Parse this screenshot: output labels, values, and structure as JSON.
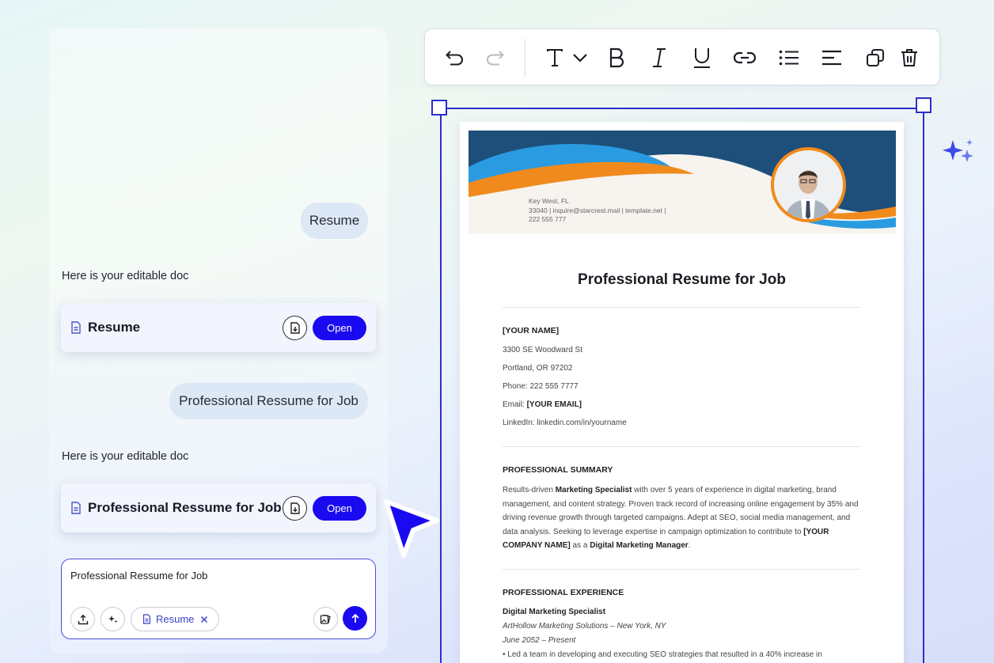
{
  "chat": {
    "user_messages": [
      "Resume",
      "Professional Ressume for Job"
    ],
    "assistant_messages": [
      "Here is your editable doc",
      "Here is your editable doc"
    ],
    "doc_cards": [
      {
        "title": "Resume",
        "open_label": "Open"
      },
      {
        "title": "Professional Ressume for Job",
        "open_label": "Open"
      }
    ],
    "input": {
      "value": "Professional Ressume for Job",
      "chip_label": "Resume"
    }
  },
  "toolbar": {
    "icons": [
      "undo-icon",
      "redo-icon",
      "text-style-icon",
      "bold-icon",
      "italic-icon",
      "underline-icon",
      "link-icon",
      "bullet-list-icon",
      "align-left-icon",
      "duplicate-icon",
      "delete-icon"
    ]
  },
  "document": {
    "header": {
      "location": "Key West, FL",
      "contact_line1": "33040 | inquire@starcrest.mail | template.net |",
      "contact_line2": "222 555 777"
    },
    "title": "Professional Resume for Job",
    "name": "[YOUR NAME]",
    "address1": "3300 SE Woodward St",
    "address2": "Portland, OR 97202",
    "phone": "Phone: 222 555 7777",
    "email_label": "Email: ",
    "email_value": "[YOUR EMAIL]",
    "linkedin": "LinkedIn: linkedin.com/in/yourname",
    "summary_heading": "PROFESSIONAL SUMMARY",
    "summary": {
      "p1": "Results-driven ",
      "b1": "Marketing Specialist",
      "p2": " with over 5 years of experience in digital marketing, brand management, and content strategy. Proven track record of increasing online engagement by 35% and driving revenue growth through targeted campaigns. Adept at SEO, social media management, and data analysis. Seeking to leverage expertise in campaign optimization to contribute to ",
      "b2": "[YOUR COMPANY NAME]",
      "p3": " as a ",
      "b3": "Digital Marketing Manager",
      "p4": "."
    },
    "experience_heading": "PROFESSIONAL EXPERIENCE",
    "job_title": "Digital Marketing Specialist",
    "job_company": "ArtHollow Marketing Solutions – New York, NY",
    "job_dates": "June 2052 – Present",
    "job_bullet": "• Led a team in developing and executing SEO strategies that resulted in a 40% increase in"
  },
  "colors": {
    "accent": "#1a0af0",
    "selection": "#2d2fcc",
    "banner_blue": "#1d4f7a",
    "banner_orange": "#f08a1c",
    "banner_light_blue": "#2a9be0"
  }
}
